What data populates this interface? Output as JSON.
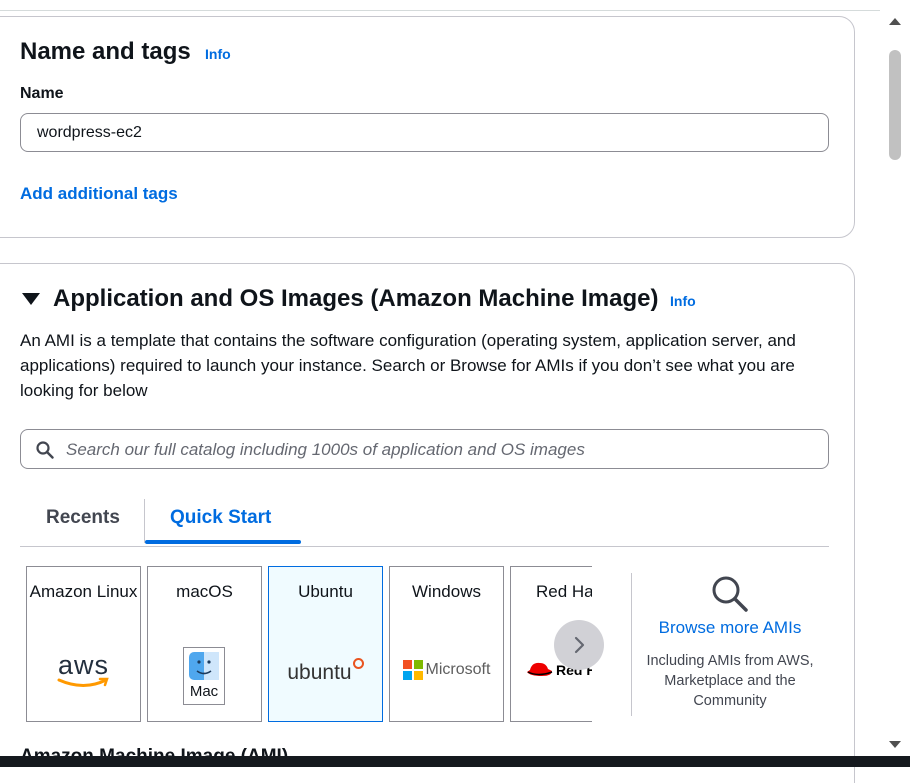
{
  "name_tags": {
    "title": "Name and tags",
    "info": "Info",
    "name_label": "Name",
    "name_value": "wordpress-ec2",
    "add_tags": "Add additional tags"
  },
  "ami": {
    "title": "Application and OS Images (Amazon Machine Image)",
    "info": "Info",
    "description": "An AMI is a template that contains the software configuration (operating system, application server, and applications) required to launch your instance. Search or Browse for AMIs if you don’t see what you are looking for below",
    "search_placeholder": "Search our full catalog including 1000s of application and OS images",
    "tabs": [
      "Recents",
      "Quick Start"
    ],
    "active_tab": "Quick Start",
    "tiles": [
      {
        "title": "Amazon Linux",
        "logo_text": "aws",
        "icon": "aws-logo-icon"
      },
      {
        "title": "macOS",
        "logo_text": "Mac",
        "icon": "mac-finder-icon"
      },
      {
        "title": "Ubuntu",
        "logo_text": "ubuntu",
        "icon": "ubuntu-logo-icon",
        "selected": true
      },
      {
        "title": "Windows",
        "logo_text": "Microsoft",
        "icon": "microsoft-logo-icon"
      },
      {
        "title": "Red Ha",
        "logo_text": "Red H",
        "icon": "redhat-logo-icon"
      }
    ],
    "browse_more": "Browse more AMIs",
    "browse_desc": "Including AMIs from AWS, Marketplace and the Community",
    "cutoff_heading": "Amazon Machine Image (AMI)"
  },
  "colors": {
    "link": "#006ce0",
    "border": "#8c8c94",
    "selected_tile_bg": "#f0fbff"
  }
}
